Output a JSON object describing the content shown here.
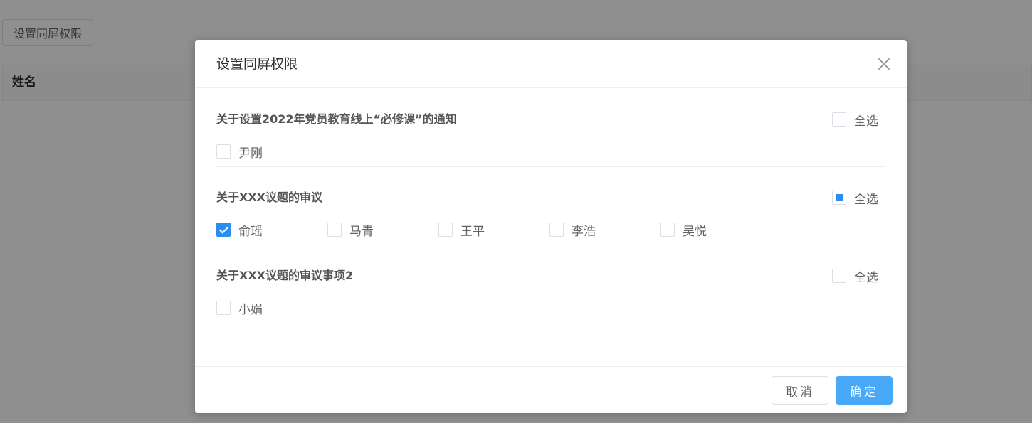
{
  "background": {
    "button_label": "设置同屏权限",
    "table_header": "姓名"
  },
  "dialog": {
    "title": "设置同屏权限",
    "close_icon": "close-icon",
    "groups": [
      {
        "title": "关于设置2022年党员教育线上“必修课”的通知",
        "select_all_label": "全选",
        "select_all_state": "unchecked",
        "members": [
          {
            "name": "尹刚",
            "checked": false
          }
        ]
      },
      {
        "title": "关于XXX议题的审议",
        "select_all_label": "全选",
        "select_all_state": "indeterminate",
        "members": [
          {
            "name": "俞瑶",
            "checked": true
          },
          {
            "name": "马青",
            "checked": false
          },
          {
            "name": "王平",
            "checked": false
          },
          {
            "name": "李浩",
            "checked": false
          },
          {
            "name": "吴悦",
            "checked": false
          }
        ]
      },
      {
        "title": "关于XXX议题的审议事项2",
        "select_all_label": "全选",
        "select_all_state": "unchecked",
        "members": [
          {
            "name": "小娟",
            "checked": false
          }
        ]
      }
    ],
    "footer": {
      "cancel_label": "取消",
      "confirm_label": "确定"
    }
  },
  "colors": {
    "primary": "#2d8cf0",
    "confirm_button": "#48a9f8",
    "border": "#dcdfe6"
  }
}
